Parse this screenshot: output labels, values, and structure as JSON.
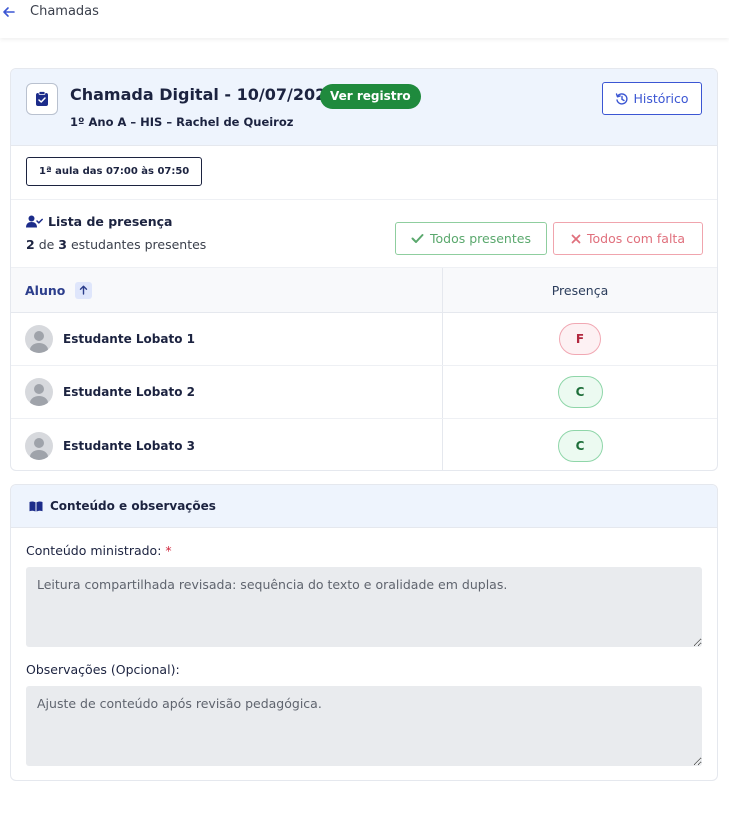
{
  "topbar": {
    "title": "Chamadas"
  },
  "header": {
    "title": "Chamada Digital - 10/07/2026",
    "badge": "Ver registro",
    "subtitle": "1º Ano A – HIS – Rachel de Queiroz",
    "history_button": "Histórico"
  },
  "lesson": {
    "label": "1ª aula das 07:00 às 07:50"
  },
  "attendance": {
    "title": "Lista de presença",
    "present_count": "2",
    "of_label": "de",
    "total_count": "3",
    "suffix": "estudantes presentes",
    "all_present_button": "Todos presentes",
    "all_absent_button": "Todos com falta"
  },
  "table": {
    "col_student": "Aluno",
    "col_presence": "Presença",
    "rows": [
      {
        "name": "Estudante Lobato 1",
        "status": "F"
      },
      {
        "name": "Estudante Lobato 2",
        "status": "C"
      },
      {
        "name": "Estudante Lobato 3",
        "status": "C"
      }
    ]
  },
  "content": {
    "title": "Conteúdo e observações",
    "content_label": "Conteúdo ministrado:",
    "required_mark": "*",
    "content_value": "Leitura compartilhada revisada: sequência do texto e oralidade em duplas.",
    "notes_label": "Observações (Opcional):",
    "notes_value": "Ajuste de conteúdo após revisão pedagógica."
  },
  "colors": {
    "accent": "#3b56d3",
    "success": "#1f8a3d",
    "danger": "#b2283f",
    "header_bg": "#eef4fd"
  }
}
